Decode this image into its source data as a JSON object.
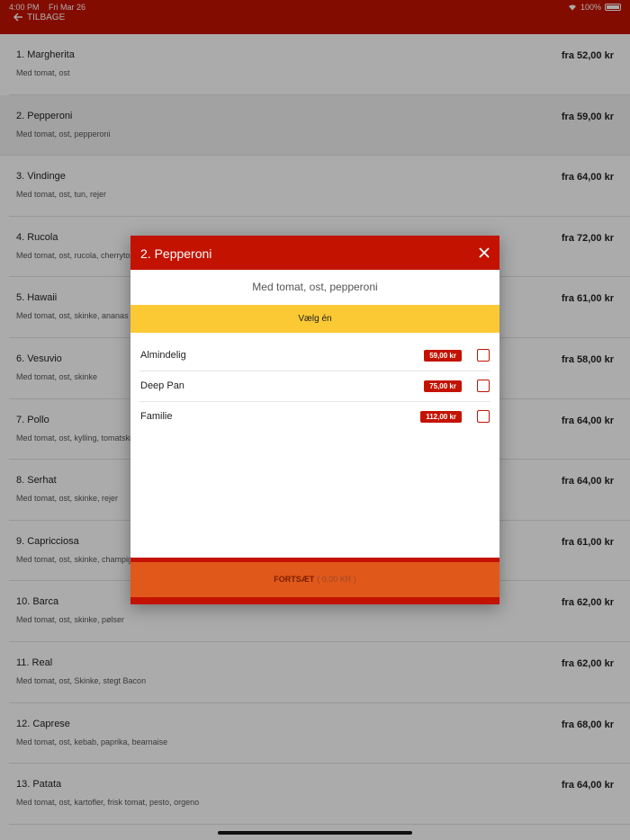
{
  "status": {
    "time": "4:00 PM",
    "date": "Fri Mar 26",
    "battery": "100%"
  },
  "nav": {
    "back_label": "TILBAGE"
  },
  "colors": {
    "brand_red": "#c41200",
    "accent_yellow": "#fbc934",
    "continue_orange": "#e0581a"
  },
  "menu": [
    {
      "name": "1. Margherita",
      "desc": "Med tomat, ost",
      "price": "fra 52,00 kr"
    },
    {
      "name": "2. Pepperoni",
      "desc": "Med tomat, ost, pepperoni",
      "price": "fra 59,00 kr"
    },
    {
      "name": "3. Vindinge",
      "desc": "Med tomat, ost, tun, rejer",
      "price": "fra 64,00 kr"
    },
    {
      "name": "4. Rucola",
      "desc": "Med tomat, ost, rucola, cherrytomat",
      "price": "fra 72,00 kr"
    },
    {
      "name": "5. Hawaii",
      "desc": "Med tomat, ost, skinke, ananas",
      "price": "fra 61,00 kr"
    },
    {
      "name": "6. Vesuvio",
      "desc": "Med tomat, ost, skinke",
      "price": "fra 58,00 kr"
    },
    {
      "name": "7. Pollo",
      "desc": "Med tomat, ost, kylling, tomatskiver",
      "price": "fra 64,00 kr"
    },
    {
      "name": "8. Serhat",
      "desc": "Med tomat, ost, skinke, rejer",
      "price": "fra 64,00 kr"
    },
    {
      "name": "9. Capricciosa",
      "desc": "Med tomat, ost, skinke, champignon",
      "price": "fra 61,00 kr"
    },
    {
      "name": "10. Barca",
      "desc": "Med tomat, ost, skinke, pølser",
      "price": "fra 62,00 kr"
    },
    {
      "name": "11. Real",
      "desc": "Med tomat, ost, Skinke, stegt Bacon",
      "price": "fra 62,00 kr"
    },
    {
      "name": "12. Caprese",
      "desc": "Med tomat, ost, kebab, paprika, bearnaise",
      "price": "fra 68,00 kr"
    },
    {
      "name": "13. Patata",
      "desc": "Med tomat, ost, kartofler, frisk tomat, pesto, orgeno",
      "price": "fra 64,00 kr"
    }
  ],
  "modal": {
    "title": "2. Pepperoni",
    "desc": "Med tomat, ost, pepperoni",
    "choose_label": "Vælg én",
    "options": [
      {
        "name": "Almindelig",
        "price": "59,00 kr"
      },
      {
        "name": "Deep Pan",
        "price": "75,00 kr"
      },
      {
        "name": "Familie",
        "price": "112,00 kr"
      }
    ],
    "continue_label": "FORTSÆT",
    "continue_amount": "( 0,00 KR )"
  }
}
